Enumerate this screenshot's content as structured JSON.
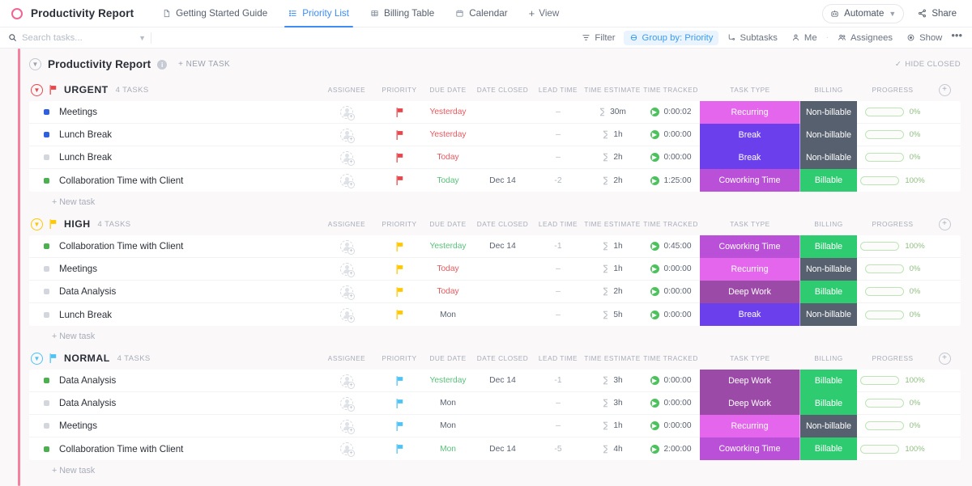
{
  "topbar": {
    "brand_icon": "circle-outline-icon",
    "brand_title": "Productivity Report",
    "tabs": [
      {
        "label": "Getting Started Guide",
        "icon": "doc-icon",
        "active": false
      },
      {
        "label": "Priority List",
        "icon": "list-icon",
        "active": true
      },
      {
        "label": "Billing Table",
        "icon": "table-icon",
        "active": false
      },
      {
        "label": "Calendar",
        "icon": "calendar-icon",
        "active": false
      }
    ],
    "add_view_label": "View",
    "automate_label": "Automate",
    "share_label": "Share"
  },
  "filterbar": {
    "search_placeholder": "Search tasks...",
    "search_value": "",
    "items": [
      {
        "label": "Filter",
        "icon": "filter-icon",
        "active": false
      },
      {
        "label": "Group by: Priority",
        "icon": "group-icon",
        "active": true
      },
      {
        "label": "Subtasks",
        "icon": "subtask-icon",
        "active": false
      },
      {
        "label": "Me",
        "icon": "person-icon",
        "active": false
      },
      {
        "label": "Assignees",
        "icon": "people-icon",
        "active": false
      },
      {
        "label": "Show",
        "icon": "eye-icon",
        "active": false
      }
    ],
    "more_label": "•••"
  },
  "list": {
    "title": "Productivity Report",
    "info_icon": "info-icon",
    "new_task_label": "+ NEW TASK",
    "hide_closed_label": "HIDE CLOSED",
    "hide_closed_icon": "check-icon"
  },
  "columns": [
    "ASSIGNEE",
    "PRIORITY",
    "DUE DATE",
    "DATE CLOSED",
    "LEAD TIME",
    "TIME ESTIMATE",
    "TIME TRACKED",
    "TASK TYPE",
    "BILLING",
    "PROGRESS"
  ],
  "add_column_icon": "plus-circle-icon",
  "new_task_row_label": "+ New task",
  "colors": {
    "accent_bar": "#f4819f",
    "urgent_flag": "#e8474c",
    "high_flag": "#ffc800",
    "normal_flag": "#4ec3f5",
    "billable": "#2ecb71",
    "non_billable": "#56606e",
    "type_recurring": "#e366ec",
    "type_break": "#6b3fec",
    "type_coworking": "#ba4fd8",
    "type_deep_work": "#9c4aa8",
    "progress_fill": "#5fc83f",
    "tab_active": "#3d8df5"
  },
  "groups": [
    {
      "name": "URGENT",
      "count_label": "4 TASKS",
      "flag_color": "#e8474c",
      "chev_color": "#e8474c",
      "tasks": [
        {
          "title": "Meetings",
          "status_color": "#2f5fe0",
          "assignee": "unassigned",
          "priority_color": "#e8474c",
          "due": "Yesterday",
          "due_style": "red",
          "date_closed": "",
          "lead_time": "–",
          "time_estimate": "30m",
          "time_tracked": "0:00:02",
          "task_type": "Recurring",
          "task_type_color": "#e366ec",
          "billing": "Non-billable",
          "billing_color": "#56606e",
          "progress": 0,
          "progress_label": "0%"
        },
        {
          "title": "Lunch Break",
          "status_color": "#2f5fe0",
          "assignee": "unassigned",
          "priority_color": "#e8474c",
          "due": "Yesterday",
          "due_style": "red",
          "date_closed": "",
          "lead_time": "–",
          "time_estimate": "1h",
          "time_tracked": "0:00:00",
          "task_type": "Break",
          "task_type_color": "#6b3fec",
          "billing": "Non-billable",
          "billing_color": "#56606e",
          "progress": 0,
          "progress_label": "0%"
        },
        {
          "title": "Lunch Break",
          "status_color": "#d3d7dd",
          "assignee": "unassigned",
          "priority_color": "#e8474c",
          "due": "Today",
          "due_style": "red",
          "date_closed": "",
          "lead_time": "–",
          "time_estimate": "2h",
          "time_tracked": "0:00:00",
          "task_type": "Break",
          "task_type_color": "#6b3fec",
          "billing": "Non-billable",
          "billing_color": "#56606e",
          "progress": 0,
          "progress_label": "0%"
        },
        {
          "title": "Collaboration Time with Client",
          "status_color": "#4caf50",
          "assignee": "unassigned",
          "priority_color": "#e8474c",
          "due": "Today",
          "due_style": "green",
          "date_closed": "Dec 14",
          "lead_time": "-2",
          "time_estimate": "2h",
          "time_tracked": "1:25:00",
          "task_type": "Coworking Time",
          "task_type_color": "#ba4fd8",
          "billing": "Billable",
          "billing_color": "#2ecb71",
          "progress": 100,
          "progress_label": "100%"
        }
      ]
    },
    {
      "name": "HIGH",
      "count_label": "4 TASKS",
      "flag_color": "#ffc800",
      "chev_color": "#ffc800",
      "tasks": [
        {
          "title": "Collaboration Time with Client",
          "status_color": "#4caf50",
          "assignee": "unassigned",
          "priority_color": "#ffc800",
          "due": "Yesterday",
          "due_style": "green",
          "date_closed": "Dec 14",
          "lead_time": "-1",
          "time_estimate": "1h",
          "time_tracked": "0:45:00",
          "task_type": "Coworking Time",
          "task_type_color": "#ba4fd8",
          "billing": "Billable",
          "billing_color": "#2ecb71",
          "progress": 100,
          "progress_label": "100%"
        },
        {
          "title": "Meetings",
          "status_color": "#d3d7dd",
          "assignee": "unassigned",
          "priority_color": "#ffc800",
          "due": "Today",
          "due_style": "red",
          "date_closed": "",
          "lead_time": "–",
          "time_estimate": "1h",
          "time_tracked": "0:00:00",
          "task_type": "Recurring",
          "task_type_color": "#e366ec",
          "billing": "Non-billable",
          "billing_color": "#56606e",
          "progress": 0,
          "progress_label": "0%"
        },
        {
          "title": "Data Analysis",
          "status_color": "#d3d7dd",
          "assignee": "unassigned",
          "priority_color": "#ffc800",
          "due": "Today",
          "due_style": "red",
          "date_closed": "",
          "lead_time": "–",
          "time_estimate": "2h",
          "time_tracked": "0:00:00",
          "task_type": "Deep Work",
          "task_type_color": "#9c4aa8",
          "billing": "Billable",
          "billing_color": "#2ecb71",
          "progress": 0,
          "progress_label": "0%"
        },
        {
          "title": "Lunch Break",
          "status_color": "#d3d7dd",
          "assignee": "unassigned",
          "priority_color": "#ffc800",
          "due": "Mon",
          "due_style": "gray",
          "date_closed": "",
          "lead_time": "–",
          "time_estimate": "5h",
          "time_tracked": "0:00:00",
          "task_type": "Break",
          "task_type_color": "#6b3fec",
          "billing": "Non-billable",
          "billing_color": "#56606e",
          "progress": 0,
          "progress_label": "0%"
        }
      ]
    },
    {
      "name": "NORMAL",
      "count_label": "4 TASKS",
      "flag_color": "#4ec3f5",
      "chev_color": "#4ec3f5",
      "tasks": [
        {
          "title": "Data Analysis",
          "status_color": "#4caf50",
          "assignee": "unassigned",
          "priority_color": "#4ec3f5",
          "due": "Yesterday",
          "due_style": "green",
          "date_closed": "Dec 14",
          "lead_time": "-1",
          "time_estimate": "3h",
          "time_tracked": "0:00:00",
          "task_type": "Deep Work",
          "task_type_color": "#9c4aa8",
          "billing": "Billable",
          "billing_color": "#2ecb71",
          "progress": 100,
          "progress_label": "100%"
        },
        {
          "title": "Data Analysis",
          "status_color": "#d3d7dd",
          "assignee": "unassigned",
          "priority_color": "#4ec3f5",
          "due": "Mon",
          "due_style": "gray",
          "date_closed": "",
          "lead_time": "–",
          "time_estimate": "3h",
          "time_tracked": "0:00:00",
          "task_type": "Deep Work",
          "task_type_color": "#9c4aa8",
          "billing": "Billable",
          "billing_color": "#2ecb71",
          "progress": 0,
          "progress_label": "0%"
        },
        {
          "title": "Meetings",
          "status_color": "#d3d7dd",
          "assignee": "unassigned",
          "priority_color": "#4ec3f5",
          "due": "Mon",
          "due_style": "gray",
          "date_closed": "",
          "lead_time": "–",
          "time_estimate": "1h",
          "time_tracked": "0:00:00",
          "task_type": "Recurring",
          "task_type_color": "#e366ec",
          "billing": "Non-billable",
          "billing_color": "#56606e",
          "progress": 0,
          "progress_label": "0%"
        },
        {
          "title": "Collaboration Time with Client",
          "status_color": "#4caf50",
          "assignee": "unassigned",
          "priority_color": "#4ec3f5",
          "due": "Mon",
          "due_style": "green",
          "date_closed": "Dec 14",
          "lead_time": "-5",
          "time_estimate": "4h",
          "time_tracked": "2:00:00",
          "task_type": "Coworking Time",
          "task_type_color": "#ba4fd8",
          "billing": "Billable",
          "billing_color": "#2ecb71",
          "progress": 100,
          "progress_label": "100%"
        }
      ]
    }
  ]
}
